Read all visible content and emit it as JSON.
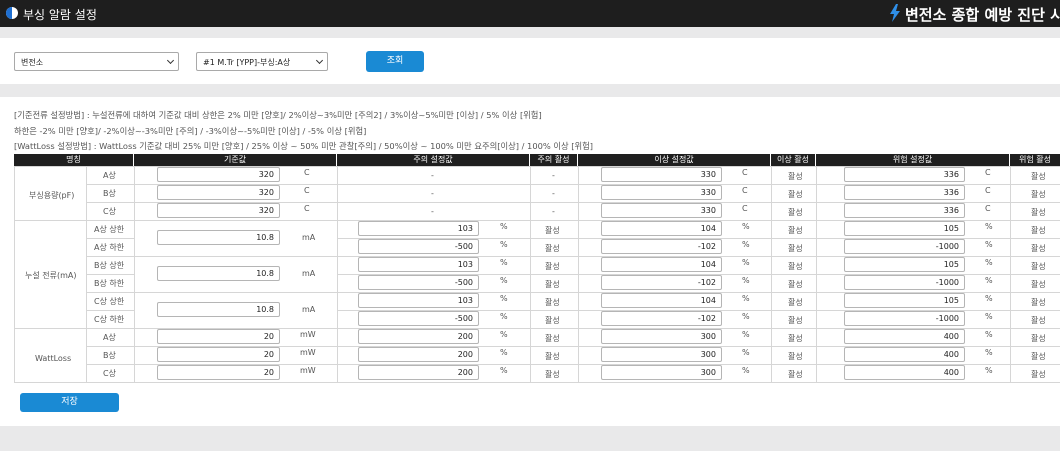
{
  "header": {
    "title": "부싱 알람 설정",
    "brand": "변전소 종합 예방 진단 시스"
  },
  "search": {
    "substation": "변전소",
    "equipment": "#1 M.Tr [YPP]-부싱:A상",
    "search_button": "조회"
  },
  "notes": [
    "[기준전류 설정방법] : 누설전류에 대하여 기준값 대비 상한은 2% 미만 [양호]/ 2%이상~3%미만 [주의2] / 3%이상~5%미만 [이상] / 5% 이상 [위험]",
    "하한은 -2% 미만 [양호]/ -2%이상~-3%미만 [주의] / -3%이상~-5%미만 [이상] / -5% 이상 [위험]",
    "[WattLoss 설정방법] : WattLoss 기준값 대비 25% 미만 [양호] / 25% 이상 ~ 50% 미만 관찰[주의] / 50%이상 ~ 100% 미만 요주의[이상] / 100% 이상 [위험]"
  ],
  "table": {
    "headers": [
      "명칭",
      "기준값",
      "주의 설정값",
      "주의 활성",
      "이상 설정값",
      "이상 활성",
      "위험 설정값",
      "위험 활성"
    ],
    "groups": [
      {
        "name": "부싱용량(pF)",
        "unit": "C",
        "rows": [
          {
            "label": "A상",
            "base": "320",
            "caution": "-",
            "caution_active": "-",
            "abnormal": "330",
            "abnormal_active": "활성",
            "danger": "336",
            "danger_active": "활성"
          },
          {
            "label": "B상",
            "base": "320",
            "caution": "-",
            "caution_active": "-",
            "abnormal": "330",
            "abnormal_active": "활성",
            "danger": "336",
            "danger_active": "활성"
          },
          {
            "label": "C상",
            "base": "320",
            "caution": "-",
            "caution_active": "-",
            "abnormal": "330",
            "abnormal_active": "활성",
            "danger": "336",
            "danger_active": "활성"
          }
        ]
      },
      {
        "name": "누설 전류(mA)",
        "unit": "mA",
        "pct": "%",
        "pairs": [
          {
            "base": "10.8",
            "rows": [
              {
                "label": "A상 상한",
                "caution": "103",
                "caution_active": "활성",
                "abnormal": "104",
                "abnormal_active": "활성",
                "danger": "105",
                "danger_active": "활성"
              },
              {
                "label": "A상 하한",
                "caution": "-500",
                "caution_active": "활성",
                "abnormal": "-102",
                "abnormal_active": "활성",
                "danger": "-1000",
                "danger_active": "활성"
              }
            ]
          },
          {
            "base": "10.8",
            "rows": [
              {
                "label": "B상 상한",
                "caution": "103",
                "caution_active": "활성",
                "abnormal": "104",
                "abnormal_active": "활성",
                "danger": "105",
                "danger_active": "활성"
              },
              {
                "label": "B상 하한",
                "caution": "-500",
                "caution_active": "활성",
                "abnormal": "-102",
                "abnormal_active": "활성",
                "danger": "-1000",
                "danger_active": "활성"
              }
            ]
          },
          {
            "base": "10.8",
            "rows": [
              {
                "label": "C상 상한",
                "caution": "103",
                "caution_active": "활성",
                "abnormal": "104",
                "abnormal_active": "활성",
                "danger": "105",
                "danger_active": "활성"
              },
              {
                "label": "C상 하한",
                "caution": "-500",
                "caution_active": "활성",
                "abnormal": "-102",
                "abnormal_active": "활성",
                "danger": "-1000",
                "danger_active": "활성"
              }
            ]
          }
        ]
      },
      {
        "name": "WattLoss",
        "unit": "mW",
        "rows": [
          {
            "label": "A상",
            "base": "20",
            "caution": "200",
            "caution_active": "활성",
            "abnormal": "300",
            "abnormal_active": "활성",
            "danger": "400",
            "danger_active": "활성"
          },
          {
            "label": "B상",
            "base": "20",
            "caution": "200",
            "caution_active": "활성",
            "abnormal": "300",
            "abnormal_active": "활성",
            "danger": "400",
            "danger_active": "활성"
          },
          {
            "label": "C상",
            "base": "20",
            "caution": "200",
            "caution_active": "활성",
            "abnormal": "300",
            "abnormal_active": "활성",
            "danger": "400",
            "danger_active": "활성"
          }
        ]
      }
    ]
  },
  "save_button": "저장",
  "colors": {
    "topbar": "#1e1e1e",
    "button": "#1a8ad4",
    "table_header": "#1f1f1f",
    "bolt": "#2f8fe8"
  }
}
